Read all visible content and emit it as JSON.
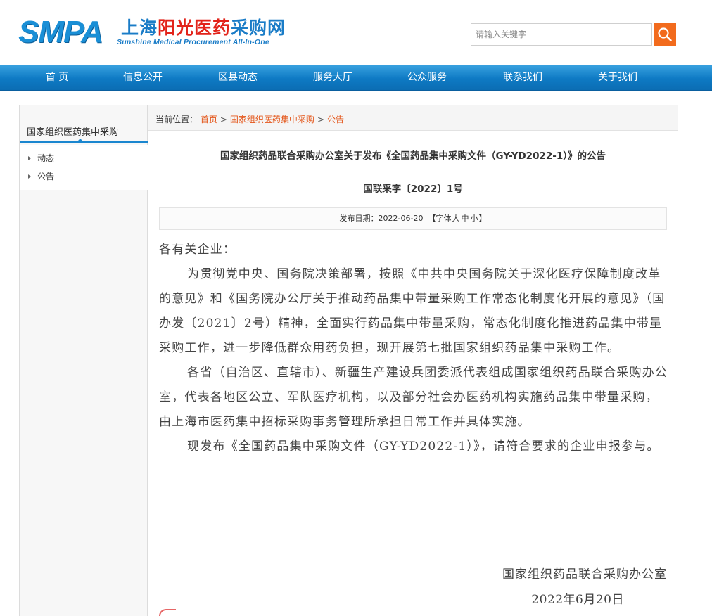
{
  "header": {
    "logo_text": "SMPA",
    "logo_cn_part1": "上海",
    "logo_cn_part2": "阳光医药",
    "logo_cn_part3": "采购网",
    "logo_en": "Sunshine Medical Procurement All-In-One",
    "search_placeholder": "请输入关键字"
  },
  "nav": {
    "items": [
      "首 页",
      "信息公开",
      "区县动态",
      "服务大厅",
      "公众服务",
      "联系我们",
      "关于我们"
    ]
  },
  "sidebar": {
    "title": "国家组织医药集中采购",
    "items": [
      "动态",
      "公告"
    ]
  },
  "breadcrumb": {
    "label": "当前位置：",
    "items": [
      "首页",
      "国家组织医药集中采购",
      "公告"
    ],
    "separator": ">"
  },
  "article": {
    "title": "国家组织药品联合采购办公室关于发布《全国药品集中采购文件（GY-YD2022-1）》的公告",
    "doc_no": "国联采字〔2022〕1号",
    "meta": {
      "date_label": "发布日期：",
      "date": "2022-06-20",
      "font_open": "【字体",
      "font_large": "大",
      "font_medium": "中",
      "font_small": "小",
      "font_close": "】"
    },
    "salutation": "各有关企业：",
    "paragraphs": [
      "为贯彻党中央、国务院决策部署，按照《中共中央国务院关于深化医疗保障制度改革的意见》和《国务院办公厅关于推动药品集中带量采购工作常态化制度化开展的意见》（国办发〔2021〕2号）精神，全面实行药品集中带量采购，常态化制度化推进药品集中带量采购工作，进一步降低群众用药负担，现开展第七批国家组织药品集中采购工作。",
      "各省（自治区、直辖市）、新疆生产建设兵团委派代表组成国家组织药品联合采购办公室，代表各地区公立、军队医疗机构，以及部分社会办医药机构实施药品集中带量采购，由上海市医药集中招标采购事务管理所承担日常工作并具体实施。",
      "现发布《全国药品集中采购文件（GY-YD2022-1）》，请符合要求的企业申报参与。"
    ],
    "signature_org": "国家组织药品联合采购办公室",
    "signature_date": "2022年6月20日"
  },
  "colors": {
    "brand_blue": "#1a8fd6",
    "nav_blue": "#0e7ac4",
    "accent_orange": "#f26b1d",
    "link_orange": "#e4561a",
    "logo_red": "#e2231a"
  }
}
